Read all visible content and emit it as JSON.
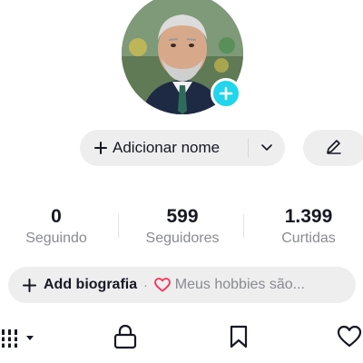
{
  "profile": {
    "add_name_label": "Adicionar nome",
    "icons": {
      "add_badge": "plus-icon",
      "name_plus": "plus-icon",
      "dropdown": "chevron-down-icon",
      "edit": "pencil-icon"
    }
  },
  "stats": [
    {
      "value": "0",
      "label": "Seguindo"
    },
    {
      "value": "599",
      "label": "Seguidores"
    },
    {
      "value": "1.399",
      "label": "Curtidas"
    }
  ],
  "bio": {
    "add_label": "Add biografia",
    "separator": "·",
    "hint": "Meus hobbies são..."
  },
  "tabs": [
    {
      "icon": "grid-icon",
      "active": true
    },
    {
      "icon": "lock-icon",
      "active": false
    },
    {
      "icon": "bookmark-icon",
      "active": false
    },
    {
      "icon": "heart-icon",
      "active": false
    }
  ],
  "colors": {
    "accent": "#20d5ec",
    "heart": "#fe2c55",
    "text": "#161823",
    "muted": "#8a8b91",
    "button_bg": "#eeeeef"
  }
}
